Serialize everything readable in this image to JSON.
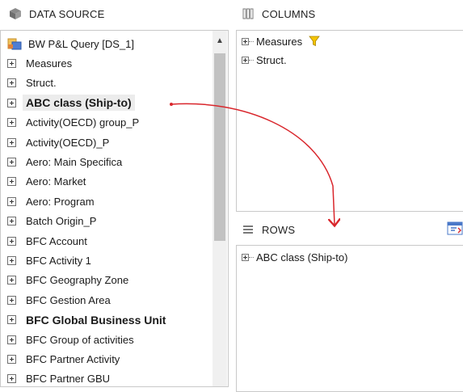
{
  "data_source": {
    "title": "DATA SOURCE",
    "root": "BW P&L Query [DS_1]",
    "items": [
      {
        "label": "Measures",
        "bold": false
      },
      {
        "label": "Struct.",
        "bold": false
      },
      {
        "label": "ABC class (Ship-to)",
        "bold": true
      },
      {
        "label": "Activity(OECD) group_P",
        "bold": false
      },
      {
        "label": "Activity(OECD)_P",
        "bold": false
      },
      {
        "label": "Aero: Main Specifica",
        "bold": false
      },
      {
        "label": "Aero: Market",
        "bold": false
      },
      {
        "label": "Aero: Program",
        "bold": false
      },
      {
        "label": "Batch Origin_P",
        "bold": false
      },
      {
        "label": "BFC Account",
        "bold": false
      },
      {
        "label": "BFC Activity 1",
        "bold": false
      },
      {
        "label": "BFC Geography Zone",
        "bold": false
      },
      {
        "label": "BFC Gestion Area",
        "bold": false
      },
      {
        "label": "BFC Global Business Unit",
        "bold": true
      },
      {
        "label": "BFC Group of activities",
        "bold": false
      },
      {
        "label": "BFC Partner Activity",
        "bold": false
      },
      {
        "label": "BFC Partner GBU",
        "bold": false
      }
    ]
  },
  "columns": {
    "title": "COLUMNS",
    "items": [
      "Measures",
      "Struct."
    ]
  },
  "rows": {
    "title": "ROWS",
    "items": [
      "ABC class (Ship-to)"
    ]
  },
  "colors": {
    "arrow": "#d9262c",
    "filter": "#f5c400",
    "panel_border": "#c9c9c9"
  }
}
